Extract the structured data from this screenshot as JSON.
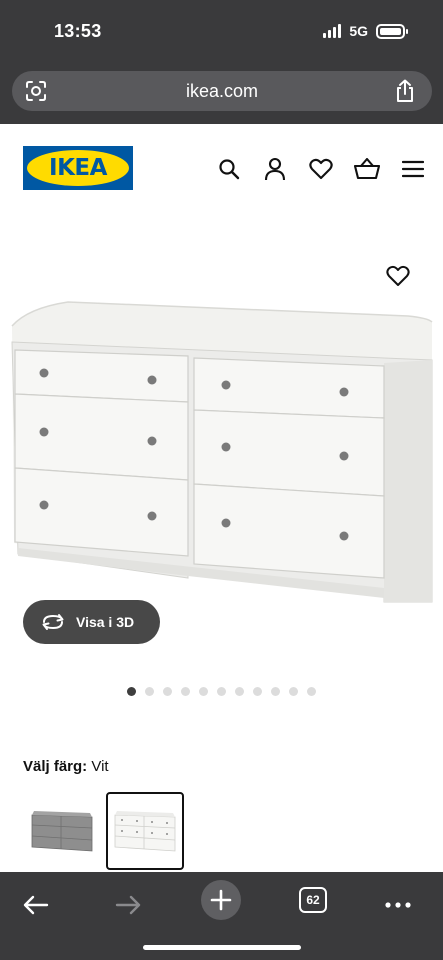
{
  "status_bar": {
    "time": "13:53",
    "network": "5G",
    "battery_level": 1.0
  },
  "browser": {
    "url": "ikea.com",
    "tab_count": "62"
  },
  "header": {
    "logo_text": "IKEA",
    "icons": [
      "search-icon",
      "account-icon",
      "favourites-icon",
      "basket-icon",
      "menu-icon"
    ]
  },
  "product": {
    "favourite_icon": "heart-icon",
    "view_3d_label": "Visa i 3D",
    "gallery": {
      "total": 11,
      "active_index": 0
    }
  },
  "color_picker": {
    "label": "Välj färg:",
    "selected_value": "Vit",
    "options": [
      {
        "name": "grey",
        "color": "#8c8c8c",
        "selected": false
      },
      {
        "name": "white",
        "color": "#f4f4f1",
        "selected": true
      }
    ]
  },
  "colors": {
    "browser_chrome": "#3a3a3c",
    "ikea_blue": "#0058a3",
    "ikea_yellow": "#ffdb00",
    "button_dark": "#484848"
  }
}
